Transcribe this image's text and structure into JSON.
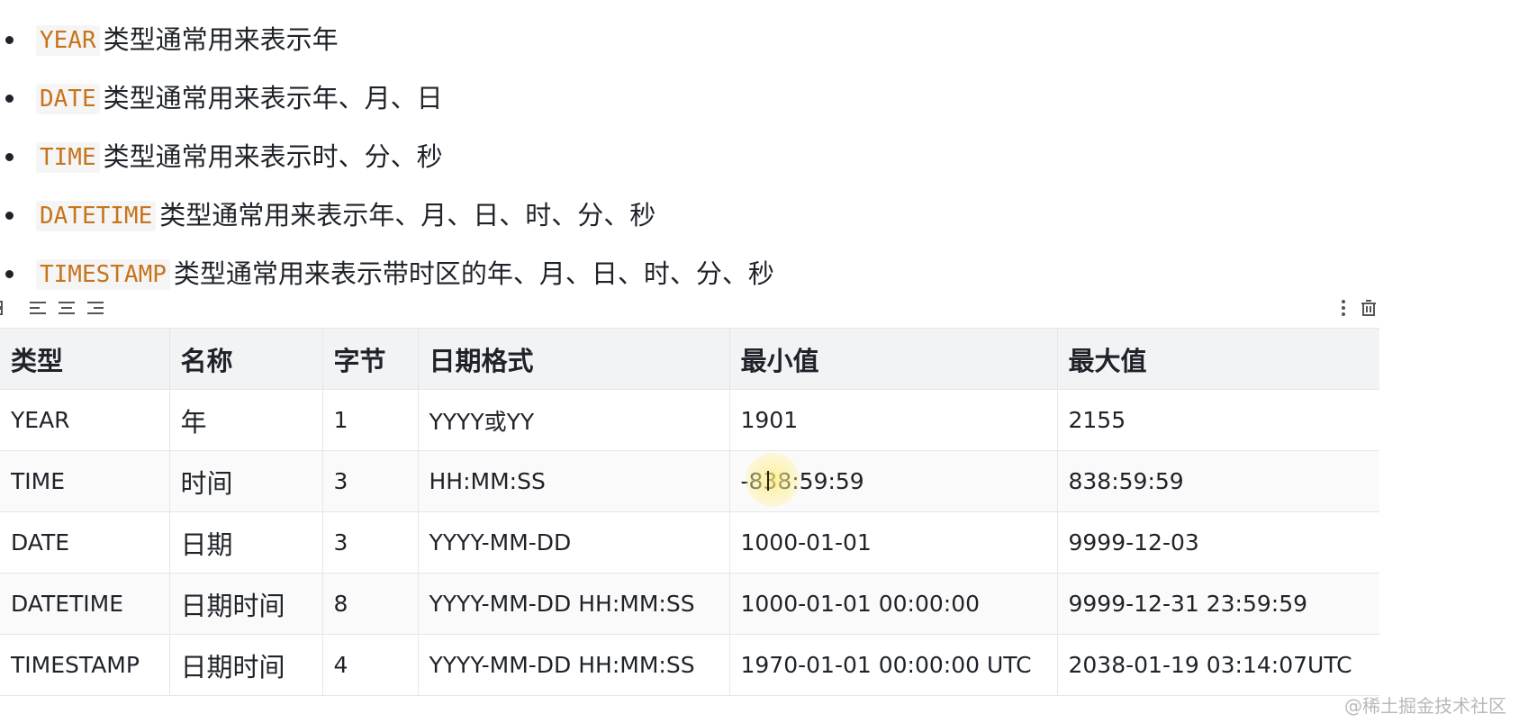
{
  "bullets": [
    {
      "code": "YEAR",
      "desc": "类型通常用来表示年"
    },
    {
      "code": "DATE",
      "desc": "类型通常用来表示年、月、日"
    },
    {
      "code": "TIME",
      "desc": "类型通常用来表示时、分、秒"
    },
    {
      "code": "DATETIME",
      "desc": "类型通常用来表示年、月、日、时、分、秒"
    },
    {
      "code": "TIMESTAMP",
      "desc": "类型通常用来表示带时区的年、月、日、时、分、秒"
    }
  ],
  "toolbar": {
    "icons": [
      "table-grid-icon",
      "align-left-icon",
      "align-center-icon",
      "align-right-icon",
      "more-vertical-icon",
      "trash-icon"
    ]
  },
  "table": {
    "headers": [
      "类型",
      "名称",
      "字节",
      "日期格式",
      "最小值",
      "最大值"
    ],
    "rows": [
      [
        "YEAR",
        "年",
        "1",
        "YYYY或YY",
        "1901",
        "2155"
      ],
      [
        "TIME",
        "时间",
        "3",
        "HH:MM:SS",
        "-838:59:59",
        "838:59:59"
      ],
      [
        "DATE",
        "日期",
        "3",
        "YYYY-MM-DD",
        "1000-01-01",
        "9999-12-03"
      ],
      [
        "DATETIME",
        "日期时间",
        "8",
        "YYYY-MM-DD HH:MM:SS",
        "1000-01-01 00:00:00",
        "9999-12-31 23:59:59"
      ],
      [
        "TIMESTAMP",
        "日期时间",
        "4",
        "YYYY-MM-DD HH:MM:SS",
        "1970-01-01 00:00:00 UTC",
        "2038-01-19 03:14:07UTC"
      ]
    ]
  },
  "colors": {
    "code_text": "#c7741b",
    "code_bg": "#f5f5f5",
    "header_bg": "#f2f3f5",
    "border": "#e5e6eb"
  },
  "watermark": "@稀土掘金技术社区"
}
